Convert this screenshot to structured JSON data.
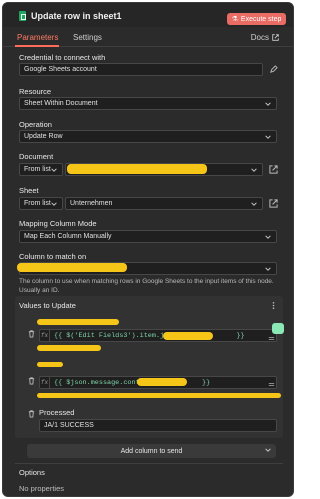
{
  "header": {
    "title": "Update row in sheet1",
    "execute_label": "Execute step"
  },
  "tabs": {
    "parameters": "Parameters",
    "settings": "Settings",
    "docs": "Docs"
  },
  "credential": {
    "label": "Credential to connect with",
    "value": "Google Sheets account"
  },
  "resource": {
    "label": "Resource",
    "value": "Sheet Within Document"
  },
  "operation": {
    "label": "Operation",
    "value": "Update Row"
  },
  "document": {
    "label": "Document",
    "mode": "From list"
  },
  "sheet": {
    "label": "Sheet",
    "mode": "From list",
    "value": "Unternehmen"
  },
  "mapping": {
    "label": "Mapping Column Mode",
    "value": "Map Each Column Manually"
  },
  "column_match": {
    "label": "Column to match on",
    "hint": "The column to use when matching rows in Google Sheets to the input items of this node. Usually an ID."
  },
  "values_to_update": {
    "label": "Values to Update",
    "expr1": "{{ $('Edit Fields3').item.json.",
    "expr1_end": "}}",
    "expr2": "{{ $json.message.content.",
    "expr2_end": "}}",
    "processed_label": "Processed",
    "processed_value": "JA/1 SUCCESS",
    "add_column": "Add column to send"
  },
  "options": {
    "label": "Options",
    "empty": "No properties"
  }
}
